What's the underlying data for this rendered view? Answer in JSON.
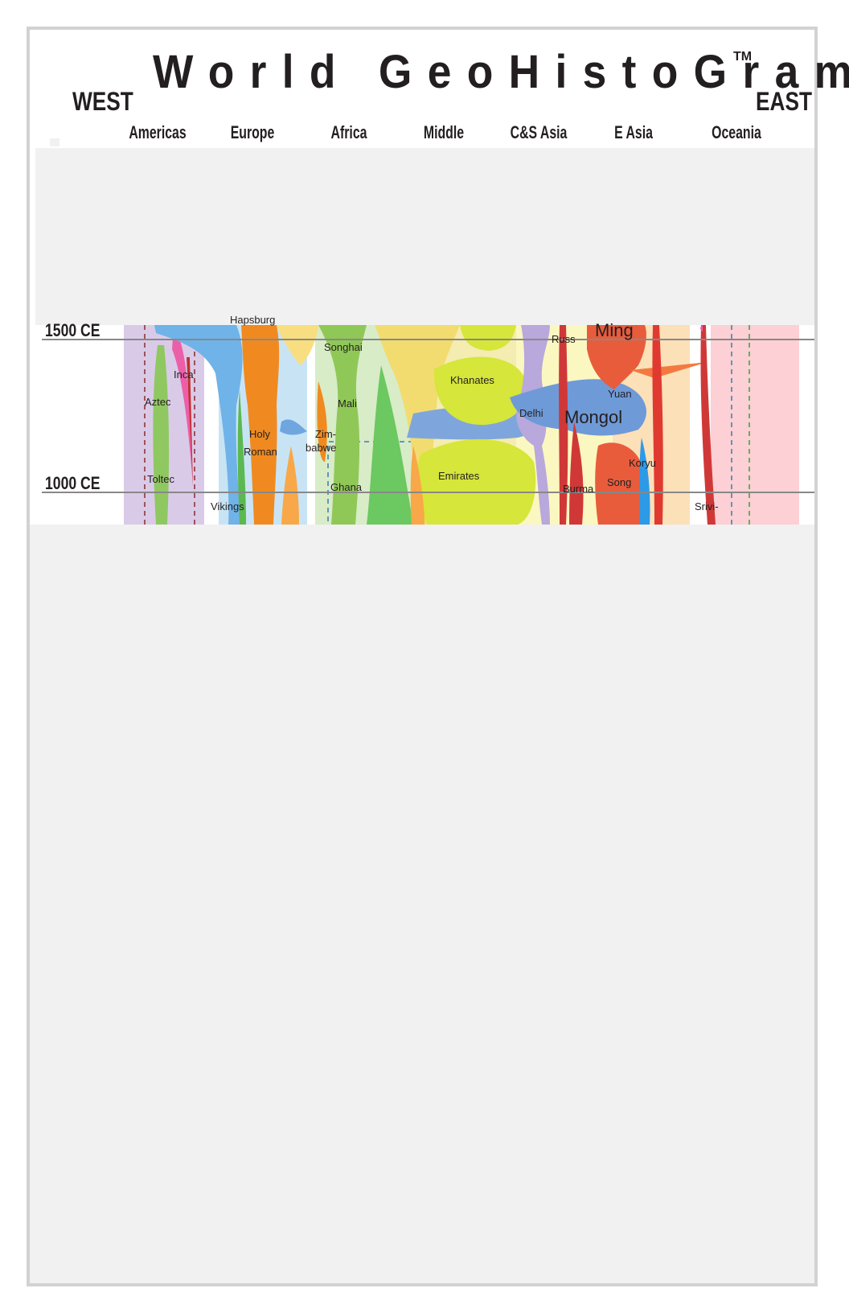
{
  "title": "World GeoHistoGram",
  "trademark": "TM",
  "direction": {
    "west": "WEST",
    "east": "EAST"
  },
  "regions": [
    "Americas",
    "Europe",
    "Africa",
    "Middle",
    "C&S Asia",
    "E Asia",
    "Oceania"
  ],
  "eras": [
    "1500 CE",
    "1000 CE"
  ],
  "labels": {
    "hapsburg": "Hapsburg",
    "songhai": "Songhai",
    "inca": "Inca",
    "aztec": "Aztec",
    "mali": "Mali",
    "holy": "Holy",
    "roman": "Roman",
    "zim": "Zim-",
    "babwe": "babwe",
    "ghana": "Ghana",
    "toltec": "Toltec",
    "vikings": "Vikings",
    "khanates": "Khanates",
    "emirates": "Emirates",
    "delhi": "Delhi",
    "russ": "Russ",
    "ming": "Ming",
    "yuan": "Yuan",
    "mongol": "Mongol",
    "koryu": "Koryu",
    "song": "Song",
    "burma": "Burma",
    "srivi": "Srivi-"
  },
  "colors": {
    "frame": "#d2d2d2",
    "mask": "#f1f1f1",
    "gridline": "#888888",
    "text": "#231f20"
  }
}
